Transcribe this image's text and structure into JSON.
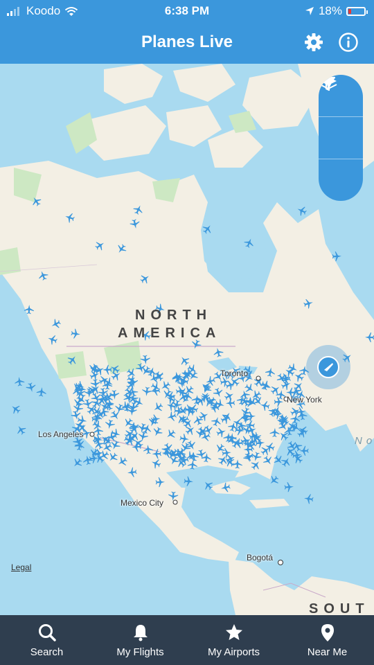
{
  "status_bar": {
    "carrier": "Koodo",
    "time": "6:38 PM",
    "battery_percent": "18%",
    "battery_level": 0.18,
    "icons": [
      "signal-icon",
      "wifi-icon",
      "location-arrow-icon",
      "battery-icon"
    ]
  },
  "header": {
    "title": "Planes Live",
    "icons": [
      "settings-gear-icon",
      "info-icon"
    ]
  },
  "map": {
    "region_labels": [
      "NORTH",
      "AMERICA",
      "SOUT"
    ],
    "ocean_label": "No",
    "cities": [
      "Toronto",
      "New York",
      "Los Angeles",
      "Mexico City",
      "Bogotá"
    ],
    "legal": "Legal",
    "controls": [
      "filter-icon",
      "layers-icon",
      "locate-icon"
    ],
    "colors": {
      "water": "#a9daf0",
      "land": "#f3efe4",
      "parks": "#cde8c3",
      "plane": "#3b97dc"
    }
  },
  "tabs": [
    {
      "label": "Search",
      "icon": "search-icon"
    },
    {
      "label": "My Flights",
      "icon": "bell-icon"
    },
    {
      "label": "My Airports",
      "icon": "star-icon"
    },
    {
      "label": "Near Me",
      "icon": "location-pin-icon"
    }
  ],
  "colors": {
    "accent": "#3b97dc",
    "tabbar": "#2f3e4f"
  }
}
